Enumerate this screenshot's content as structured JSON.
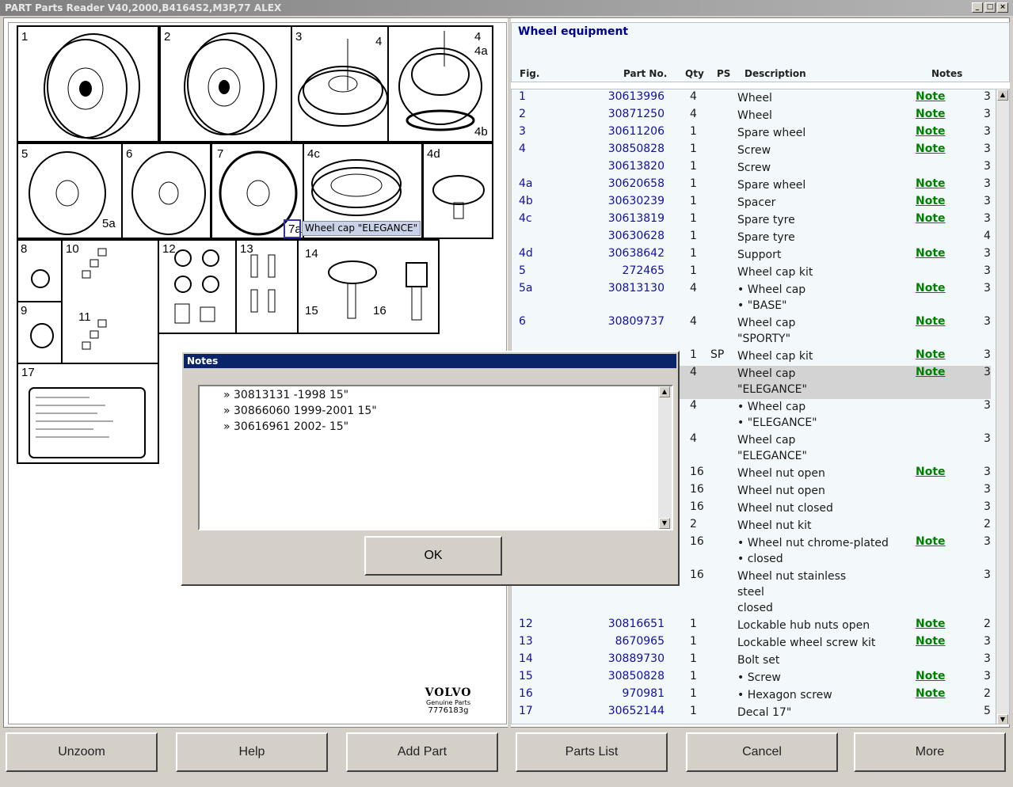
{
  "window": {
    "title": "PART Parts Reader V40,2000,B4164S2,M3P,77 ALEX"
  },
  "diagram": {
    "figures": [
      "1",
      "2",
      "3",
      "4",
      "4",
      "4a",
      "4b",
      "5",
      "5a",
      "6",
      "7",
      "7a",
      "4c",
      "4d",
      "8",
      "9",
      "10",
      "11",
      "12",
      "13",
      "14",
      "15",
      "16",
      "17"
    ],
    "tooltip": "Wheel cap \"ELEGANCE\"",
    "brand": "VOLVO",
    "brand_sub": "Genuine Parts",
    "drawing_no": "7776183g"
  },
  "section_title": "Wheel equipment",
  "columns": {
    "fig": "Fig.",
    "part": "Part No.",
    "qty": "Qty",
    "ps": "PS",
    "desc": "Description",
    "notes": "Notes"
  },
  "rows": [
    {
      "fig": "1",
      "part": "30613996",
      "qty": "4",
      "ps": "",
      "desc": [
        "Wheel"
      ],
      "note": "Note",
      "n": "3"
    },
    {
      "fig": "2",
      "part": "30871250",
      "qty": "4",
      "ps": "",
      "desc": [
        "Wheel"
      ],
      "note": "Note",
      "n": "3"
    },
    {
      "fig": "3",
      "part": "30611206",
      "qty": "1",
      "ps": "",
      "desc": [
        "Spare wheel"
      ],
      "note": "Note",
      "n": "3"
    },
    {
      "fig": "4",
      "part": "30850828",
      "qty": "1",
      "ps": "",
      "desc": [
        "Screw"
      ],
      "note": "Note",
      "n": "3"
    },
    {
      "fig": "",
      "part": "30613820",
      "qty": "1",
      "ps": "",
      "desc": [
        "Screw"
      ],
      "note": "",
      "n": "3"
    },
    {
      "fig": "4a",
      "part": "30620658",
      "qty": "1",
      "ps": "",
      "desc": [
        "Spare wheel"
      ],
      "note": "Note",
      "n": "3"
    },
    {
      "fig": "4b",
      "part": "30630239",
      "qty": "1",
      "ps": "",
      "desc": [
        "Spacer"
      ],
      "note": "Note",
      "n": "3"
    },
    {
      "fig": "4c",
      "part": "30613819",
      "qty": "1",
      "ps": "",
      "desc": [
        "Spare tyre"
      ],
      "note": "Note",
      "n": "3"
    },
    {
      "fig": "",
      "part": "30630628",
      "qty": "1",
      "ps": "",
      "desc": [
        "Spare tyre"
      ],
      "note": "",
      "n": "4"
    },
    {
      "fig": "4d",
      "part": "30638642",
      "qty": "1",
      "ps": "",
      "desc": [
        "Support"
      ],
      "note": "Note",
      "n": "3"
    },
    {
      "fig": "5",
      "part": "272465",
      "qty": "1",
      "ps": "",
      "desc": [
        "Wheel cap kit"
      ],
      "note": "",
      "n": "3"
    },
    {
      "fig": "5a",
      "part": "30813130",
      "qty": "4",
      "ps": "",
      "desc": [
        "• Wheel cap",
        "• \"BASE\""
      ],
      "note": "Note",
      "n": "3"
    },
    {
      "fig": "6",
      "part": "30809737",
      "qty": "4",
      "ps": "",
      "desc": [
        "Wheel cap",
        "\"SPORTY\""
      ],
      "note": "Note",
      "n": "3"
    },
    {
      "fig": "",
      "part": "",
      "qty": "1",
      "ps": "SP",
      "desc": [
        "Wheel cap kit"
      ],
      "note": "Note",
      "n": "3"
    },
    {
      "fig": "",
      "part": "",
      "qty": "4",
      "ps": "",
      "desc": [
        "Wheel cap",
        "\"ELEGANCE\""
      ],
      "note": "Note",
      "n": "3",
      "selected": true
    },
    {
      "fig": "",
      "part": "",
      "qty": "4",
      "ps": "",
      "desc": [
        "• Wheel cap",
        "• \"ELEGANCE\""
      ],
      "note": "",
      "n": "3"
    },
    {
      "fig": "",
      "part": "",
      "qty": "4",
      "ps": "",
      "desc": [
        "Wheel cap",
        "\"ELEGANCE\""
      ],
      "note": "",
      "n": "3"
    },
    {
      "fig": "",
      "part": "",
      "qty": "16",
      "ps": "",
      "desc": [
        "Wheel nut open"
      ],
      "note": "Note",
      "n": "3"
    },
    {
      "fig": "",
      "part": "",
      "qty": "16",
      "ps": "",
      "desc": [
        "Wheel nut open"
      ],
      "note": "",
      "n": "3"
    },
    {
      "fig": "",
      "part": "",
      "qty": "16",
      "ps": "",
      "desc": [
        "Wheel nut closed"
      ],
      "note": "",
      "n": "3"
    },
    {
      "fig": "",
      "part": "",
      "qty": "2",
      "ps": "",
      "desc": [
        "Wheel nut kit"
      ],
      "note": "",
      "n": "2"
    },
    {
      "fig": "",
      "part": "",
      "qty": "16",
      "ps": "",
      "desc": [
        "• Wheel nut chrome-plated",
        "• closed"
      ],
      "note": "Note",
      "n": "3"
    },
    {
      "fig": "",
      "part": "",
      "qty": "16",
      "ps": "",
      "desc": [
        "Wheel nut stainless",
        "steel",
        "closed"
      ],
      "note": "",
      "n": "3"
    },
    {
      "fig": "12",
      "part": "30816651",
      "qty": "1",
      "ps": "",
      "desc": [
        "Lockable hub nuts open"
      ],
      "note": "Note",
      "n": "2"
    },
    {
      "fig": "13",
      "part": "8670965",
      "qty": "1",
      "ps": "",
      "desc": [
        "Lockable wheel screw kit"
      ],
      "note": "Note",
      "n": "3"
    },
    {
      "fig": "14",
      "part": "30889730",
      "qty": "1",
      "ps": "",
      "desc": [
        "Bolt set"
      ],
      "note": "",
      "n": "3"
    },
    {
      "fig": "15",
      "part": "30850828",
      "qty": "1",
      "ps": "",
      "desc": [
        "• Screw"
      ],
      "note": "Note",
      "n": "3"
    },
    {
      "fig": "16",
      "part": "970981",
      "qty": "1",
      "ps": "",
      "desc": [
        "• Hexagon screw"
      ],
      "note": "Note",
      "n": "2"
    },
    {
      "fig": "17",
      "part": "30652144",
      "qty": "1",
      "ps": "",
      "desc": [
        "Decal 17\""
      ],
      "note": "",
      "n": "5"
    }
  ],
  "dialog": {
    "title": "Notes",
    "lines": [
      "» 30813131 -1998 15\"",
      "» 30866060 1999-2001 15\"",
      "» 30616961 2002- 15\""
    ],
    "ok": "OK"
  },
  "buttons": [
    "Unzoom",
    "Help",
    "Add Part",
    "Parts List",
    "Cancel",
    "More"
  ]
}
